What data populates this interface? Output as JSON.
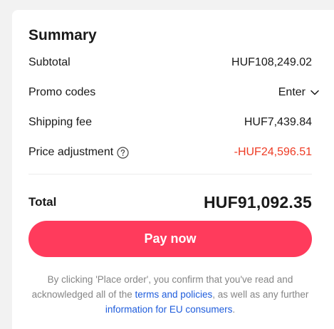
{
  "summary": {
    "title": "Summary",
    "subtotal_label": "Subtotal",
    "subtotal_value": "HUF108,249.02",
    "promo_label": "Promo codes",
    "promo_action": "Enter",
    "shipping_label": "Shipping fee",
    "shipping_value": "HUF7,439.84",
    "adjust_label": "Price adjustment",
    "adjust_value": "-HUF24,596.51",
    "total_label": "Total",
    "total_value": "HUF91,092.35"
  },
  "pay_button_label": "Pay now",
  "legal": {
    "text_1": "By clicking 'Place order', you confirm that you've read and acknowledged all of the ",
    "terms_link": "terms and policies",
    "text_2": ", as well as any further ",
    "eu_link": "information for EU consumers",
    "text_3": "."
  },
  "colors": {
    "pay_button": "#ff3b5c",
    "negative": "#ee3b24",
    "link": "#1e5cdc",
    "muted_text": "#858585"
  },
  "icons": {
    "promo_toggle": "chevron-down-icon",
    "adjust_help": "question-circle-icon"
  }
}
